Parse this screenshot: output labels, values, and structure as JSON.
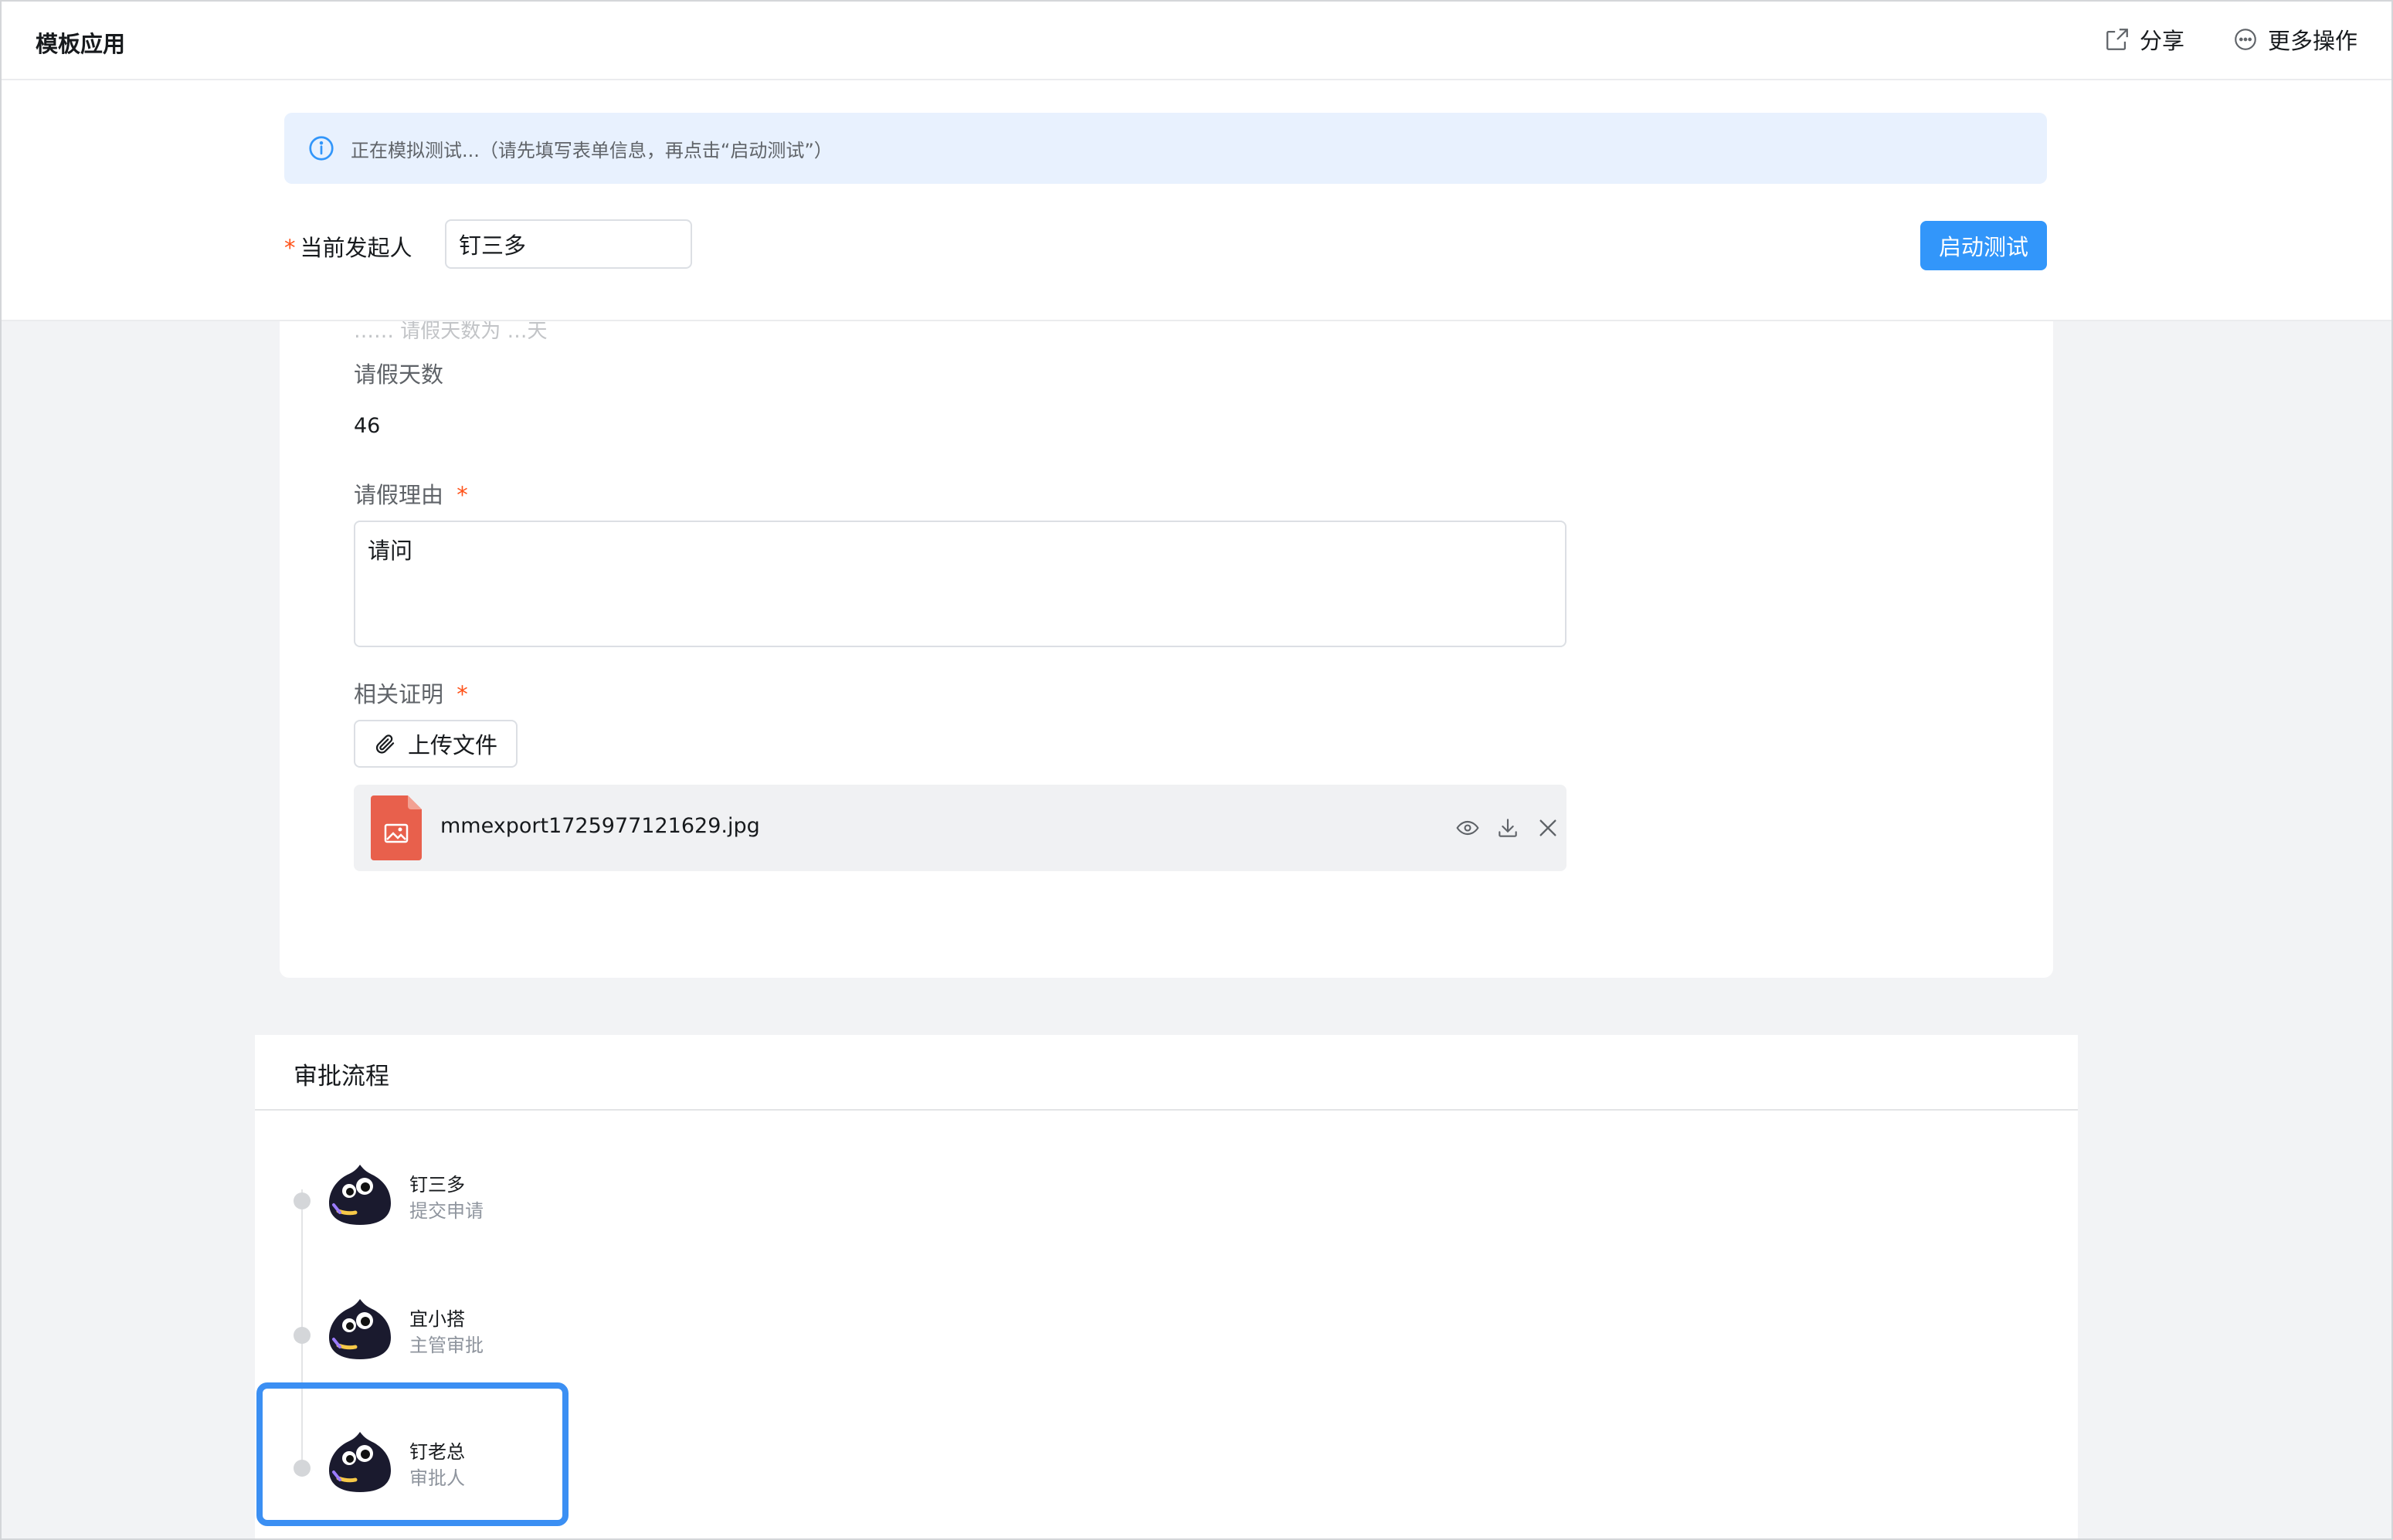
{
  "header": {
    "app_title": "模板应用",
    "share_label": "分享",
    "more_label": "更多操作"
  },
  "test_panel": {
    "info_text": "正在模拟测试...（请先填写表单信息，再点击“启动测试”）",
    "initiator_label": "当前发起人",
    "initiator_value": "钉三多",
    "start_button": "启动测试"
  },
  "form": {
    "cut_off_text": "…… 请假天数为 …天",
    "leave_days_label": "请假天数",
    "leave_days_value": "46",
    "reason_label": "请假理由",
    "reason_value": "请问",
    "proof_label": "相关证明",
    "upload_label": "上传文件",
    "file": {
      "name": "mmexport1725977121629.jpg",
      "icon": "image-file-icon",
      "icon_color": "#e8604c"
    }
  },
  "approval": {
    "title": "审批流程",
    "nodes": [
      {
        "name": "钉三多",
        "role": "提交申请"
      },
      {
        "name": "宜小搭",
        "role": "主管审批"
      },
      {
        "name": "钉老总",
        "role": "审批人"
      }
    ]
  },
  "colors": {
    "primary": "#3296fa",
    "info_bg": "#e8f1fe",
    "required": "#ff5219",
    "highlight": "#3b8ff3"
  }
}
